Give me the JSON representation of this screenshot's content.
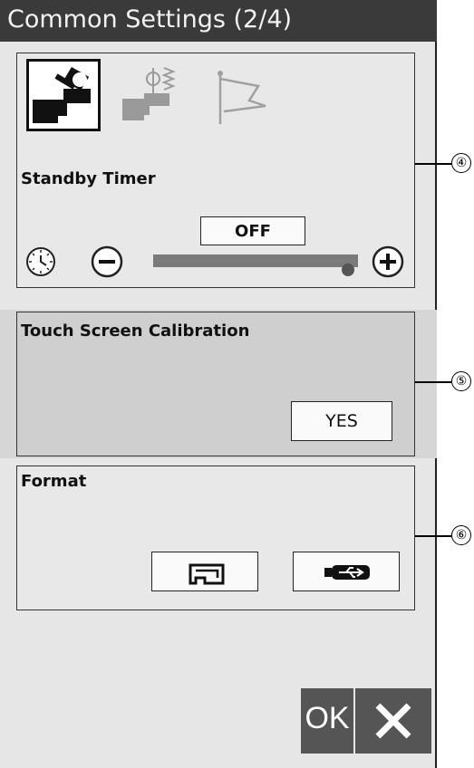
{
  "header": {
    "title": "Common Settings (2/4)"
  },
  "mode_tabs": [
    {
      "icon": "machine-wrench-icon",
      "selected": true
    },
    {
      "icon": "machine-stitch-icon",
      "selected": false
    },
    {
      "icon": "flag-icon",
      "selected": false
    }
  ],
  "standby": {
    "label": "Standby Timer",
    "value": "OFF",
    "level": 1.0,
    "minus_icon": "minus-icon",
    "plus_icon": "plus-icon",
    "clock_icon": "clock-icon"
  },
  "calibration": {
    "label": "Touch Screen Calibration",
    "button": "YES"
  },
  "format": {
    "label": "Format",
    "buttons": [
      "machine-memory-icon",
      "usb-icon"
    ]
  },
  "footer": {
    "ok": "OK",
    "close_icon": "close-icon"
  },
  "callouts": [
    "④",
    "⑤",
    "⑥"
  ]
}
